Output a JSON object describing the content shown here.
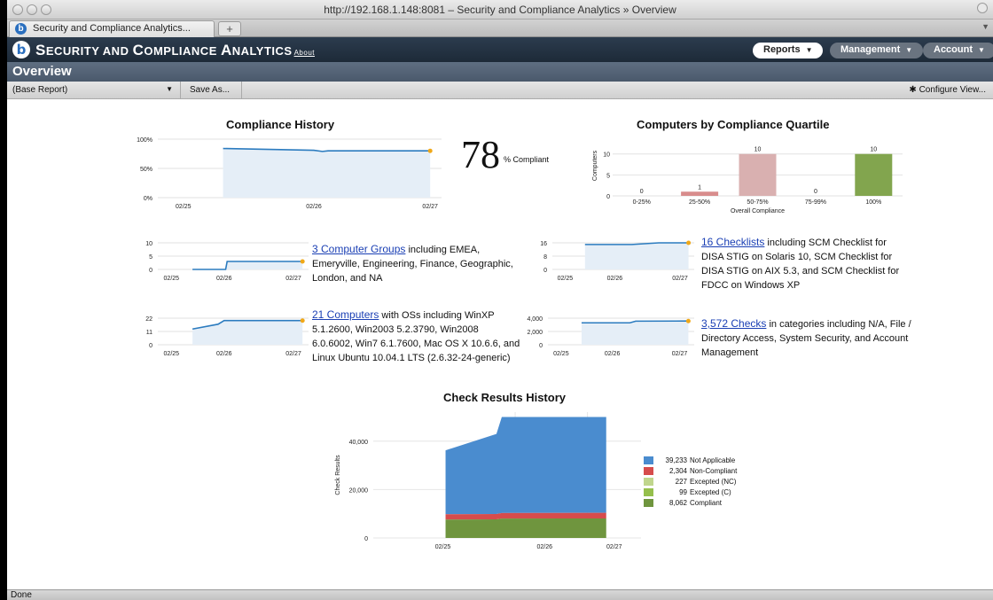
{
  "window": {
    "url_title": "http://192.168.1.148:8081 – Security and Compliance Analytics » Overview"
  },
  "tabs": {
    "active_label": "Security and Compliance Analytics...",
    "new_tab": "+",
    "favicon_letter": "b"
  },
  "app": {
    "title_big1": "S",
    "title_small1": "ECURITY AND ",
    "title_big2": "C",
    "title_small2": "OMPLIANCE ",
    "title_big3": "A",
    "title_small3": "NALYTICS",
    "about": "About",
    "nav": {
      "reports": "Reports",
      "management": "Management",
      "account": "Account"
    }
  },
  "page": {
    "title": "Overview"
  },
  "toolbar": {
    "report": "(Base Report)",
    "save_as": "Save As...",
    "configure": "Configure View..."
  },
  "compliance": {
    "title": "Compliance History",
    "value": "78",
    "suffix": "% Compliant"
  },
  "quartile_title": "Computers by Compliance Quartile",
  "groups": {
    "link": "3 Computer Groups",
    "text": " including EMEA, Emeryville, Engineering, Finance, Geographic, London, and NA"
  },
  "checklists": {
    "link": "16 Checklists",
    "text": " including SCM Checklist for DISA STIG on Solaris 10, SCM Checklist for DISA STIG on AIX 5.3, and SCM Checklist for FDCC on Windows XP"
  },
  "computers": {
    "link": "21 Computers",
    "text": " with OSs including WinXP 5.1.2600, Win2003 5.2.3790, Win2008 6.0.6002, Win7 6.1.7600, Mac OS X 10.6.6, and Linux Ubuntu 10.04.1 LTS (2.6.32-24-generic)"
  },
  "checks": {
    "link": "3,572 Checks",
    "text": " in categories including N/A, File / Directory Access, System Security, and Account Management"
  },
  "check_results_title": "Check Results History",
  "status": "Done",
  "colors": {
    "area_fill": "#e5eef7",
    "line": "#2b7bbf",
    "dot": "#f0a818"
  },
  "chart_data": [
    {
      "id": "compliance_history",
      "type": "area",
      "title": "Compliance History",
      "x_ticks": [
        "02/25",
        "02/26",
        "02/27"
      ],
      "y_ticks": [
        "100%",
        "50%",
        "0%"
      ],
      "ylim": [
        0,
        100
      ],
      "x": [
        0.23,
        0.55,
        0.58,
        0.6,
        0.75,
        0.96
      ],
      "y": [
        84,
        81,
        79,
        80,
        80,
        80
      ]
    },
    {
      "id": "quartile",
      "type": "bar",
      "title": "Computers by Compliance Quartile",
      "categories": [
        "0-25%",
        "25-50%",
        "50-75%",
        "75-99%",
        "100%"
      ],
      "values": [
        0,
        1,
        10,
        0,
        10
      ],
      "colors": [
        "#d88c8c",
        "#d88c8c",
        "#d9b0b0",
        "#b7cf95",
        "#82a54e"
      ],
      "ylabel": "Computers",
      "xlabel": "Overall Compliance",
      "y_ticks": [
        "10",
        "5",
        "0"
      ],
      "ylim": [
        0,
        11
      ]
    },
    {
      "id": "groups_history",
      "type": "area",
      "x_ticks": [
        "02/25",
        "02/26",
        "02/27"
      ],
      "y_ticks": [
        "10",
        "5",
        "0"
      ],
      "ylim": [
        0,
        10
      ],
      "x": [
        0.23,
        0.45,
        0.46,
        0.96
      ],
      "y": [
        0,
        0,
        3,
        3
      ]
    },
    {
      "id": "checklists_history",
      "type": "area",
      "x_ticks": [
        "02/25",
        "02/26",
        "02/27"
      ],
      "y_ticks": [
        "16",
        "8",
        "0"
      ],
      "ylim": [
        0,
        16
      ],
      "x": [
        0.23,
        0.56,
        0.75,
        0.96
      ],
      "y": [
        15,
        15,
        16,
        16
      ]
    },
    {
      "id": "computers_history",
      "type": "area",
      "x_ticks": [
        "02/25",
        "02/26",
        "02/27"
      ],
      "y_ticks": [
        "22",
        "11",
        "0"
      ],
      "ylim": [
        0,
        22
      ],
      "x": [
        0.23,
        0.4,
        0.44,
        0.96
      ],
      "y": [
        13,
        17,
        20,
        20
      ]
    },
    {
      "id": "checks_history",
      "type": "area",
      "x_ticks": [
        "02/25",
        "02/26",
        "02/27"
      ],
      "y_ticks": [
        "4,000",
        "2,000",
        "0"
      ],
      "ylim": [
        0,
        4000
      ],
      "x": [
        0.23,
        0.56,
        0.6,
        0.96
      ],
      "y": [
        3300,
        3300,
        3550,
        3572
      ]
    },
    {
      "id": "check_results_history",
      "type": "area",
      "title": "Check Results History",
      "ylabel": "Check Results",
      "x_ticks": [
        "02/25",
        "02/26",
        "02/27"
      ],
      "y_ticks": [
        "40,000",
        "20,000",
        "0"
      ],
      "ylim": [
        0,
        52000
      ],
      "legend": [
        {
          "value": "39,233",
          "label": "Not Applicable",
          "color": "#4a8ccf"
        },
        {
          "value": "2,304",
          "label": "Non-Compliant",
          "color": "#d64c4c"
        },
        {
          "value": "227",
          "label": "Excepted (NC)",
          "color": "#c0d68d"
        },
        {
          "value": "99",
          "label": "Excepted (C)",
          "color": "#95bf4c"
        },
        {
          "value": "8,062",
          "label": "Compliant",
          "color": "#6f953e"
        }
      ]
    }
  ]
}
